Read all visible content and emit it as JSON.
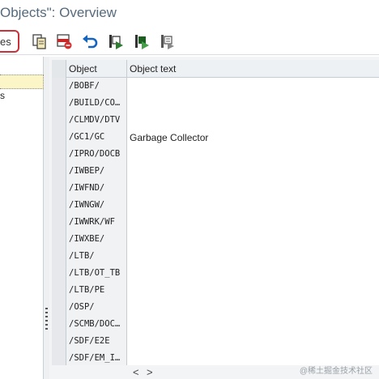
{
  "window": {
    "title": "Objects\": Overview"
  },
  "toolbar": {
    "partial_button_label": "es",
    "icons": [
      "copy-icon",
      "delete-row-icon",
      "undo-icon",
      "transport-icon",
      "transport-green-icon",
      "transport-list-icon"
    ]
  },
  "left_pane": {
    "items": [
      "s"
    ]
  },
  "table": {
    "columns": [
      "Object",
      "Object text"
    ],
    "rows": [
      {
        "object": "/BOBF/",
        "text": ""
      },
      {
        "object": "/BUILD/CO…",
        "text": ""
      },
      {
        "object": "/CLMDV/DTV",
        "text": ""
      },
      {
        "object": "/GC1/GC",
        "text": "Garbage Collector"
      },
      {
        "object": "/IPRO/DOCB",
        "text": ""
      },
      {
        "object": "/IWBEP/",
        "text": ""
      },
      {
        "object": "/IWFND/",
        "text": ""
      },
      {
        "object": "/IWNGW/",
        "text": ""
      },
      {
        "object": "/IWWRK/WF",
        "text": ""
      },
      {
        "object": "/IWXBE/",
        "text": ""
      },
      {
        "object": "/LTB/",
        "text": ""
      },
      {
        "object": "/LTB/OT_TB",
        "text": ""
      },
      {
        "object": "/LTB/PE",
        "text": ""
      },
      {
        "object": "/OSP/",
        "text": ""
      },
      {
        "object": "/SCMB/DOC…",
        "text": ""
      },
      {
        "object": "/SDF/E2E",
        "text": ""
      },
      {
        "object": "/SDF/EM_I…",
        "text": ""
      }
    ]
  },
  "scroll": {
    "left": "<",
    "right": ">"
  },
  "watermark": "@稀土掘金技术社区"
}
